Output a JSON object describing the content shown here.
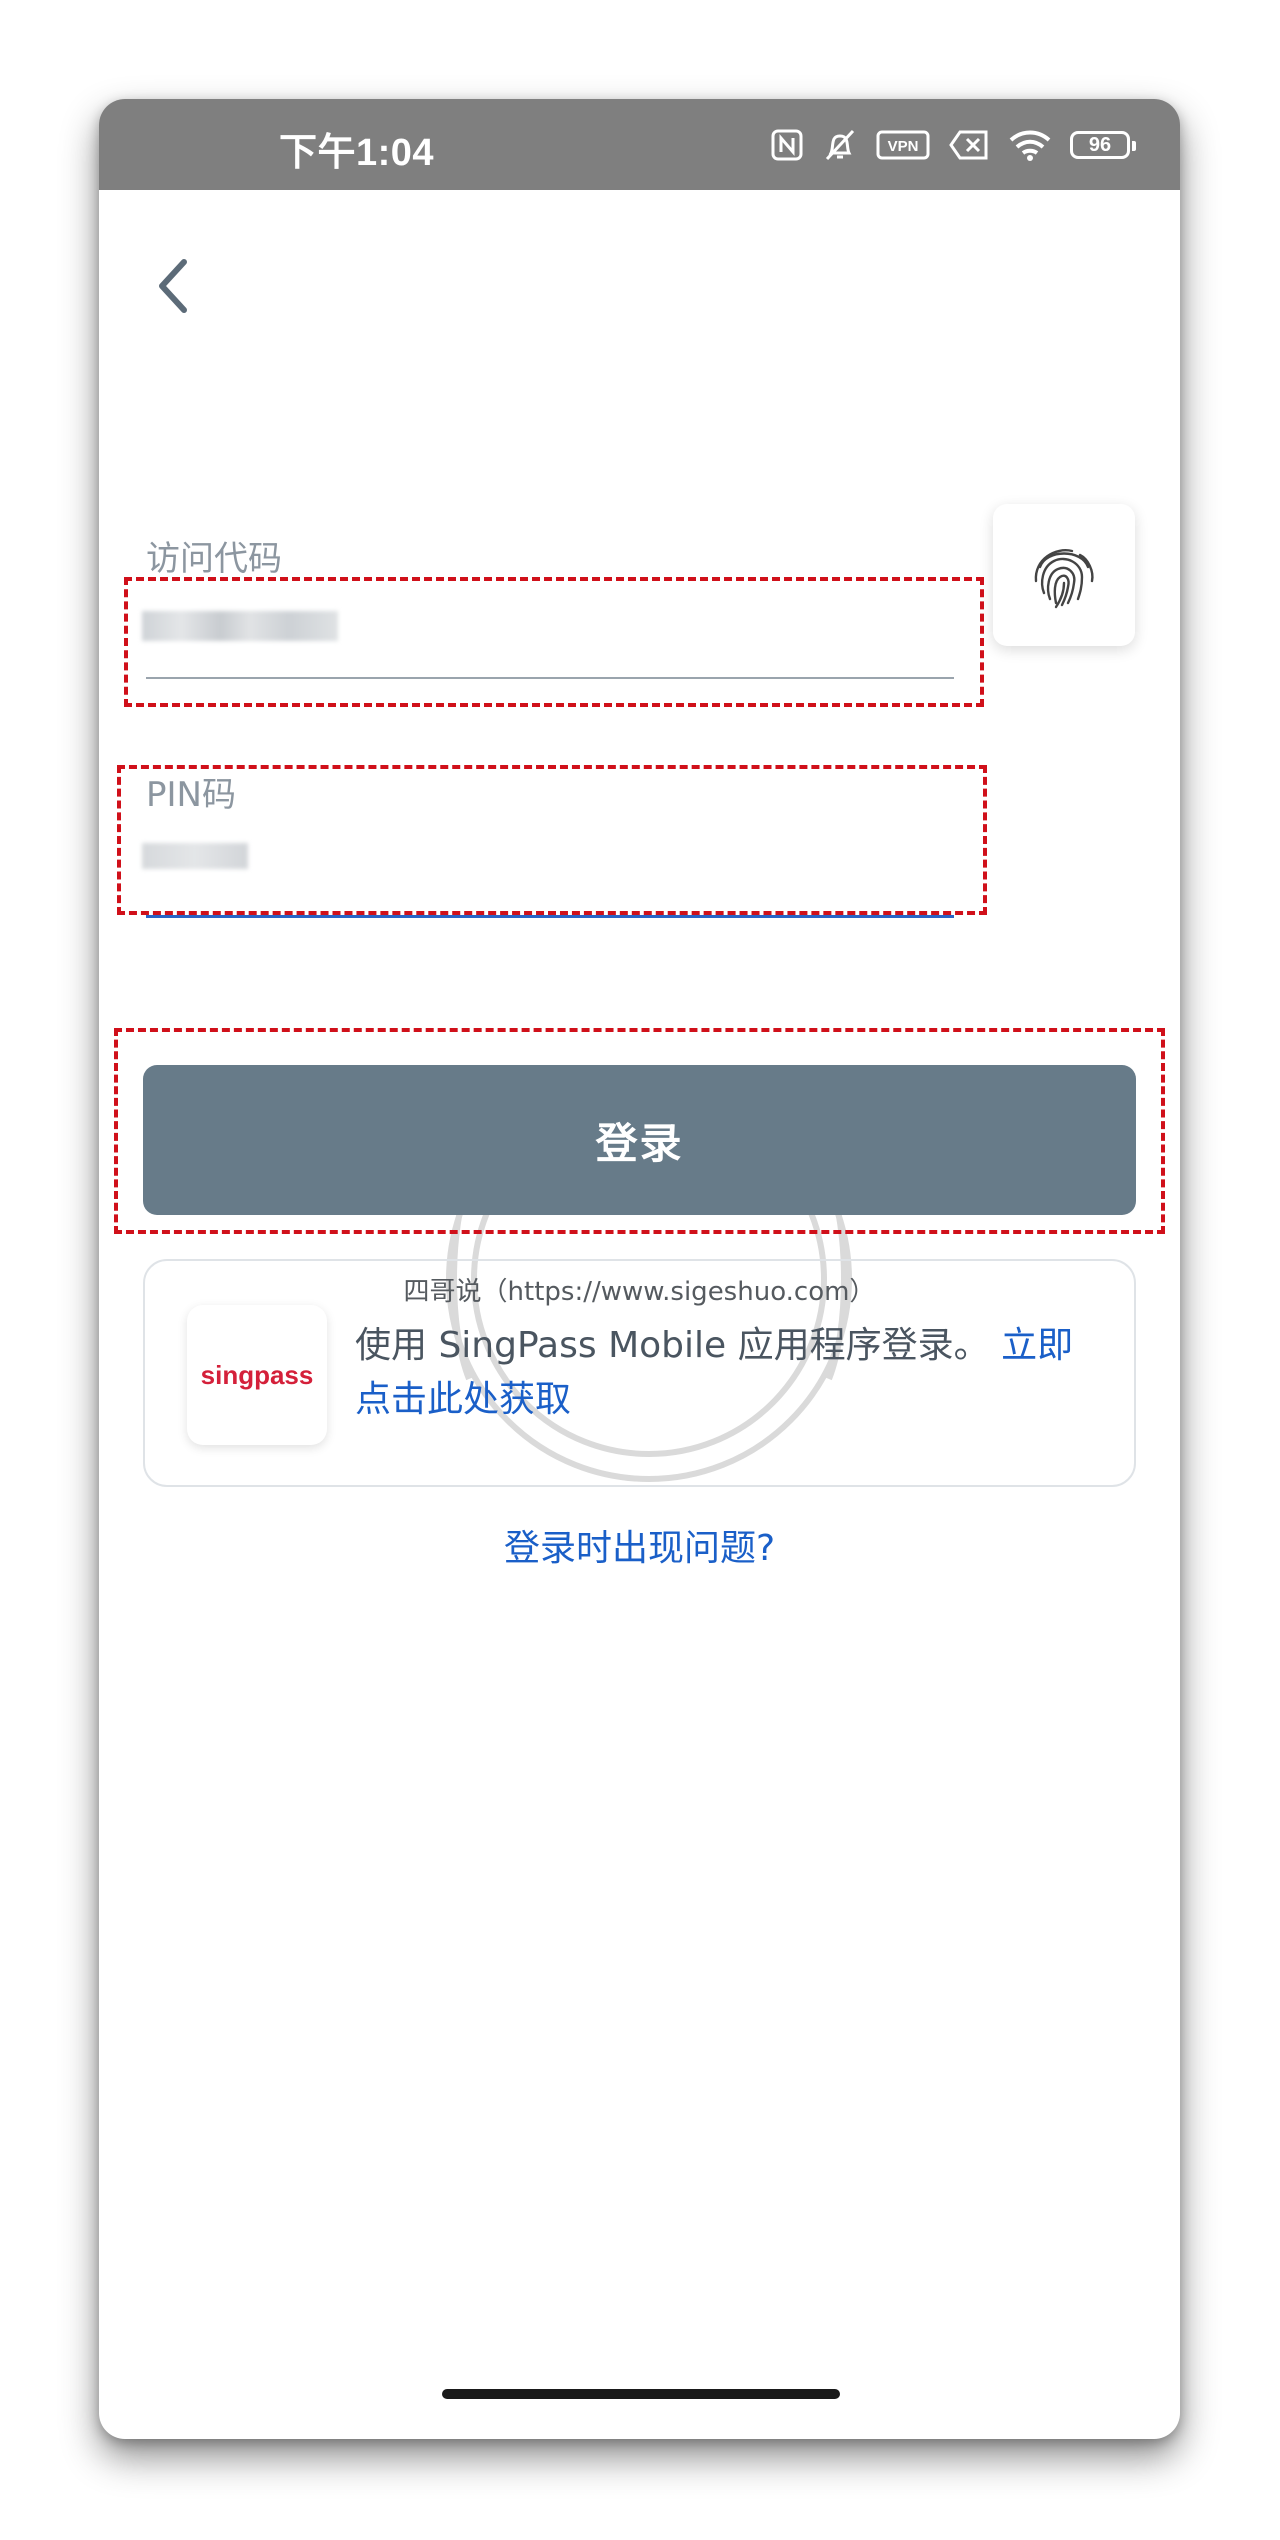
{
  "status_bar": {
    "time": "下午1:04",
    "vpn_label": "VPN",
    "battery": "96"
  },
  "form": {
    "access_code_label": "访问代码",
    "pin_label": "PIN码",
    "login_button": "登录"
  },
  "singpass": {
    "logo_text": "singpass",
    "description": "使用 SingPass Mobile 应用程序登录。",
    "link_text": "立即点击此处获取"
  },
  "trouble_link": "登录时出现问题?",
  "watermark": "四哥说（https://www.sigeshuo.com）",
  "colors": {
    "status_bar": "#7f7f7f",
    "login_button": "#677b89",
    "link": "#1a5fc8",
    "singpass_red": "#d4203a",
    "annotation_red": "#d0101a"
  }
}
